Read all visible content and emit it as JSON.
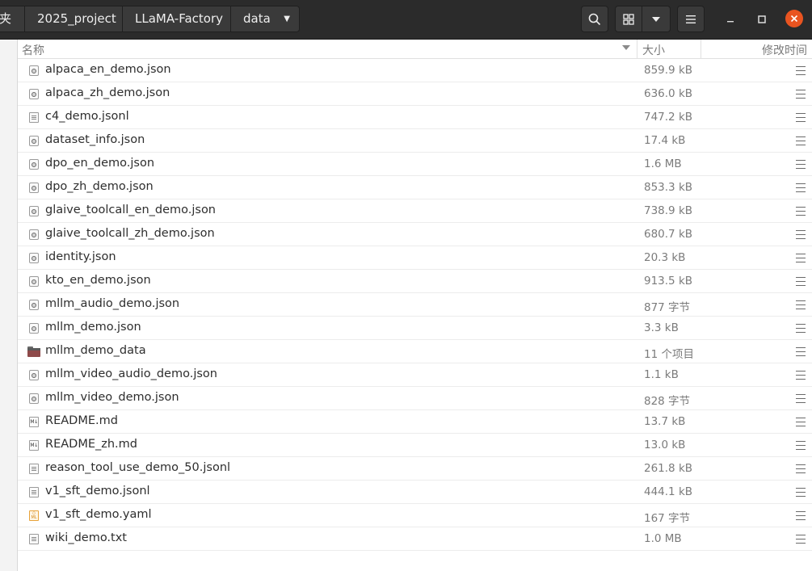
{
  "breadcrumb": {
    "first_partial": "夹",
    "items": [
      "2025_project",
      "LLaMA-Factory",
      "data"
    ]
  },
  "header": {
    "search_icon": "search-icon",
    "view_icon": "grid-view-icon",
    "view_menu_icon": "chevron-down-icon",
    "app_menu_icon": "hamburger-menu-icon",
    "minimize_icon": "minimize-icon",
    "maximize_icon": "maximize-icon",
    "close_icon": "close-icon",
    "close_color": "#e95420"
  },
  "columns": {
    "name": "名称",
    "size": "大小",
    "modified": "修改时间"
  },
  "files": [
    {
      "name": "alpaca_en_demo.json",
      "size": "859.9 kB",
      "type": "json"
    },
    {
      "name": "alpaca_zh_demo.json",
      "size": "636.0 kB",
      "type": "json"
    },
    {
      "name": "c4_demo.jsonl",
      "size": "747.2 kB",
      "type": "text"
    },
    {
      "name": "dataset_info.json",
      "size": "17.4 kB",
      "type": "json"
    },
    {
      "name": "dpo_en_demo.json",
      "size": "1.6 MB",
      "type": "json"
    },
    {
      "name": "dpo_zh_demo.json",
      "size": "853.3 kB",
      "type": "json"
    },
    {
      "name": "glaive_toolcall_en_demo.json",
      "size": "738.9 kB",
      "type": "json"
    },
    {
      "name": "glaive_toolcall_zh_demo.json",
      "size": "680.7 kB",
      "type": "json"
    },
    {
      "name": "identity.json",
      "size": "20.3 kB",
      "type": "json"
    },
    {
      "name": "kto_en_demo.json",
      "size": "913.5 kB",
      "type": "json"
    },
    {
      "name": "mllm_audio_demo.json",
      "size": "877 字节",
      "type": "json"
    },
    {
      "name": "mllm_demo.json",
      "size": "3.3 kB",
      "type": "json"
    },
    {
      "name": "mllm_demo_data",
      "size": "11 个项目",
      "type": "folder"
    },
    {
      "name": "mllm_video_audio_demo.json",
      "size": "1.1 kB",
      "type": "json"
    },
    {
      "name": "mllm_video_demo.json",
      "size": "828 字节",
      "type": "json"
    },
    {
      "name": "README.md",
      "size": "13.7 kB",
      "type": "md"
    },
    {
      "name": "README_zh.md",
      "size": "13.0 kB",
      "type": "md"
    },
    {
      "name": "reason_tool_use_demo_50.jsonl",
      "size": "261.8 kB",
      "type": "text"
    },
    {
      "name": "v1_sft_demo.jsonl",
      "size": "444.1 kB",
      "type": "text"
    },
    {
      "name": "v1_sft_demo.yaml",
      "size": "167 字节",
      "type": "yaml"
    },
    {
      "name": "wiki_demo.txt",
      "size": "1.0 MB",
      "type": "text"
    }
  ]
}
